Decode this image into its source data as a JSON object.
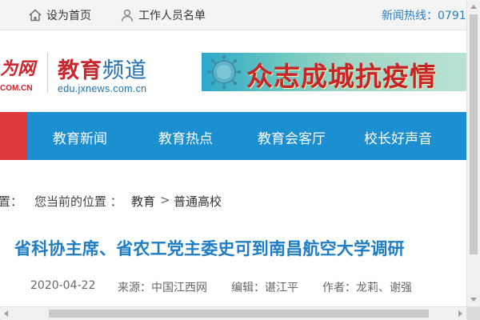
{
  "topbar": {
    "home_label": "设为首页",
    "home_icon": "home-icon",
    "staff_label": "工作人员名单",
    "staff_icon": "person-icon",
    "hotline": "新闻热线：0791"
  },
  "header": {
    "site_logo_partial": "为网",
    "site_logo_domain": "COM.CN",
    "channel_title_part1": "教育",
    "channel_title_part2": "频道",
    "channel_domain": "edu.jxnews.com.cn",
    "banner_slogan": "众志成城抗疫情"
  },
  "nav": {
    "tabs": [
      {
        "label": "教育新闻"
      },
      {
        "label": "教育热点"
      },
      {
        "label": "教育会客厅"
      },
      {
        "label": "校长好声音"
      }
    ]
  },
  "breadcrumb": {
    "cut_label": "置：",
    "current_label": "您当前的位置 ：",
    "link1": "教育",
    "separator": ">",
    "link2": "普通高校"
  },
  "article": {
    "title": "省科协主席、省农工党主委史可到南昌航空大学调研",
    "date": "2020-04-22",
    "source": "来源：中国江西网",
    "editor": "编辑：谌江平",
    "author": "作者：龙莉、谢强"
  },
  "colors": {
    "nav_blue": "#1c8fd0",
    "accent_red": "#e0383c",
    "title_blue": "#1c7dc6",
    "brand_red": "#c8252c"
  }
}
